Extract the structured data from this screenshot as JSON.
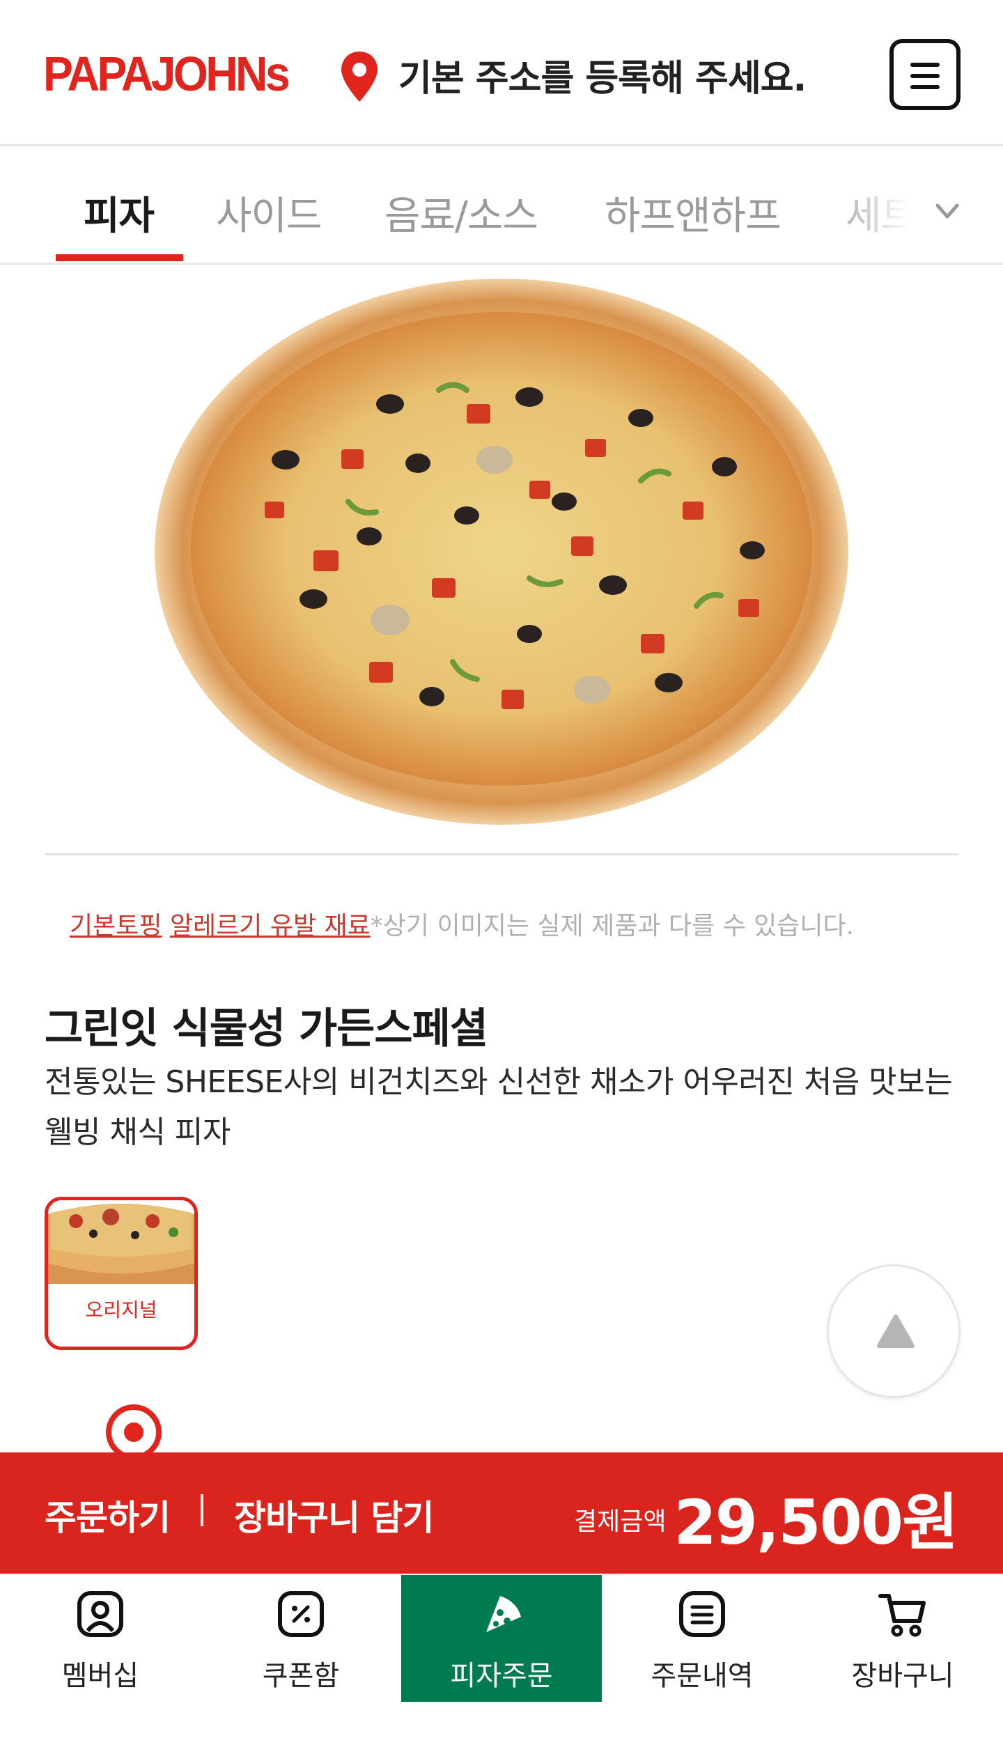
{
  "header": {
    "logo": "PAPAJOHNs",
    "address_prompt": "기본 주소를 등록해 주세요."
  },
  "tabs": [
    "피자",
    "사이드",
    "음료/소스",
    "하프앤하프",
    "세트"
  ],
  "notice": {
    "link_basic": "기본토핑",
    "link_allergy": "알레르기 유발 재료",
    "text": "*상기 이미지는 실제 제품과 다를 수 있습니다."
  },
  "product": {
    "name": "그린잇 식물성 가든스페셜",
    "description": "전통있는 SHEESE사의 비건치즈와 신선한 채소가 어우러진 처음 맛보는 웰빙 채식 피자"
  },
  "dough_options": [
    {
      "label": "오리지널",
      "selected": true
    }
  ],
  "order_bar": {
    "order_label": "주문하기",
    "cart_label": "장바구니 담기",
    "pay_label": "결제금액",
    "amount": "29,500원"
  },
  "bottom_nav": [
    {
      "label": "멤버십",
      "icon": "membership-icon",
      "active": false
    },
    {
      "label": "쿠폰함",
      "icon": "coupon-icon",
      "active": false
    },
    {
      "label": "피자주문",
      "icon": "pizza-slice-icon",
      "active": true
    },
    {
      "label": "주문내역",
      "icon": "order-history-icon",
      "active": false
    },
    {
      "label": "장바구니",
      "icon": "cart-icon",
      "active": false
    }
  ],
  "colors": {
    "brand_red": "#e0251f",
    "order_bar": "#d9251d",
    "active_nav": "#007a4f"
  }
}
